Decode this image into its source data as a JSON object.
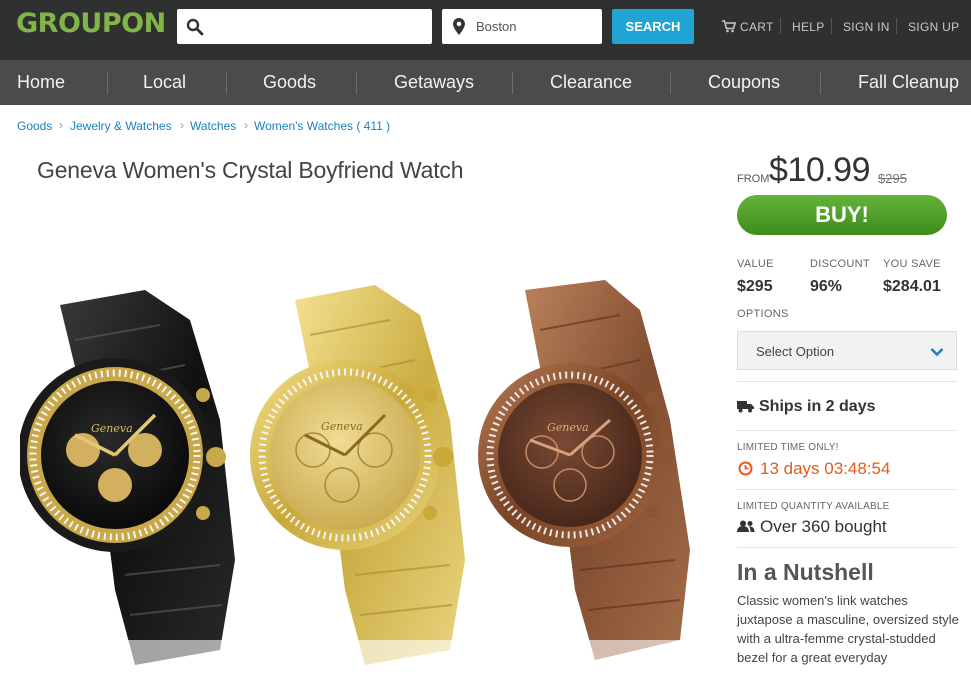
{
  "header": {
    "logo": "GROUPON",
    "search_placeholder": "",
    "location_value": "Boston",
    "search_button": "SEARCH",
    "links": [
      "CART",
      "HELP",
      "SIGN IN",
      "SIGN UP"
    ]
  },
  "nav": {
    "items": [
      "Home",
      "Local",
      "Goods",
      "Getaways",
      "Clearance",
      "Coupons",
      "Fall Cleanup"
    ]
  },
  "breadcrumb": [
    "Goods",
    "Jewelry & Watches",
    "Watches",
    "Women's Watches ( 411 )"
  ],
  "deal": {
    "title": "Geneva Women's Crystal Boyfriend Watch",
    "from_label": "FROM",
    "price": "$10.99",
    "original_price": "$295",
    "buy_label": "BUY!",
    "stats": [
      {
        "label": "VALUE",
        "value": "$295"
      },
      {
        "label": "DISCOUNT",
        "value": "96%"
      },
      {
        "label": "YOU SAVE",
        "value": "$284.01"
      }
    ],
    "options_label": "OPTIONS",
    "select_value": "Select Option",
    "ships_text": "Ships in 2 days",
    "limited_time_label": "LIMITED TIME ONLY!",
    "countdown": "13 days 03:48:54",
    "limited_qty_label": "LIMITED QUANTITY AVAILABLE",
    "bought_text": "Over 360 bought",
    "nutshell_title": "In a Nutshell",
    "nutshell_text": "Classic women's link watches juxtapose a masculine, oversized style with a ultra-femme crystal-studded bezel for a great everyday"
  },
  "watch_dials": [
    "Geneva",
    "Geneva",
    "Geneva"
  ],
  "colors": {
    "brand_green": "#82b548",
    "search_blue": "#1fa5d3",
    "buy_green": "#53a32c",
    "link_blue": "#1b80c0",
    "countdown_orange": "#e35b1a",
    "topbar": "#2f3030",
    "navbar": "#4a4b4c"
  }
}
